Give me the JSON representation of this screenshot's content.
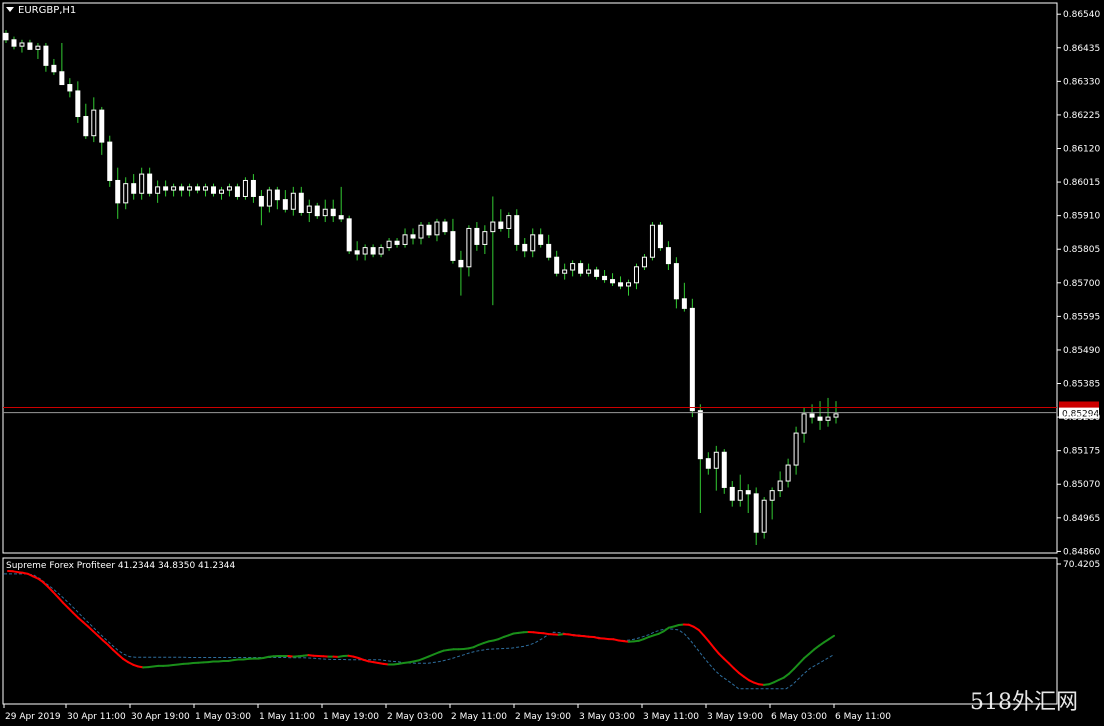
{
  "window": {
    "symbol": "EURGBP,H1"
  },
  "indicator": {
    "label": "Supreme Forex Profiteer 41.2344 34.8350 41.2344"
  },
  "watermark": {
    "text": "518外汇网"
  },
  "colors": {
    "bull": "#ffffff",
    "bear": "#ffffff",
    "wick": "#33cc33",
    "axis": "#ffffff",
    "priceline": "#cc0000",
    "ind_up": "#1a8f1a",
    "ind_down": "#ff0000",
    "ind_signal": "#2e6e9e"
  },
  "chart_data": {
    "type": "candlestick",
    "title": "EURGBP,H1",
    "ylim": [
      0.8488,
      0.8655
    ],
    "y_ticks": [
      "0.86540",
      "0.86435",
      "0.86330",
      "0.86225",
      "0.86120",
      "0.86015",
      "0.85910",
      "0.85805",
      "0.85700",
      "0.85595",
      "0.85490",
      "0.85385",
      "0.85280",
      "0.85175",
      "0.85070",
      "0.84965",
      "0.84860"
    ],
    "x_labels": [
      "29 Apr 2019",
      "30 Apr 11:00",
      "30 Apr 19:00",
      "1 May 03:00",
      "1 May 11:00",
      "1 May 19:00",
      "2 May 03:00",
      "2 May 11:00",
      "2 May 19:00",
      "3 May 03:00",
      "3 May 11:00",
      "3 May 19:00",
      "6 May 03:00",
      "6 May 11:00"
    ],
    "current_price_label": "0.85294",
    "current_price": 0.85294,
    "red_line_price": 0.8531,
    "indicator_scale_label": "70.4205",
    "candles": [
      [
        0.8648,
        0.8649,
        0.8645,
        0.8646
      ],
      [
        0.8646,
        0.8647,
        0.8643,
        0.8644
      ],
      [
        0.8644,
        0.8646,
        0.8642,
        0.8645
      ],
      [
        0.8645,
        0.8646,
        0.8643,
        0.8643
      ],
      [
        0.8643,
        0.8645,
        0.864,
        0.8644
      ],
      [
        0.8644,
        0.8645,
        0.8636,
        0.8638
      ],
      [
        0.8638,
        0.864,
        0.8635,
        0.8636
      ],
      [
        0.8636,
        0.8645,
        0.8634,
        0.8632
      ],
      [
        0.8632,
        0.8634,
        0.8628,
        0.863
      ],
      [
        0.863,
        0.8633,
        0.862,
        0.8622
      ],
      [
        0.8622,
        0.8626,
        0.8615,
        0.8616
      ],
      [
        0.8616,
        0.8628,
        0.8614,
        0.8624
      ],
      [
        0.8624,
        0.8625,
        0.861,
        0.8614
      ],
      [
        0.8614,
        0.8616,
        0.86,
        0.8602
      ],
      [
        0.8602,
        0.8606,
        0.859,
        0.8595
      ],
      [
        0.8595,
        0.8603,
        0.8593,
        0.8601
      ],
      [
        0.8601,
        0.8604,
        0.8596,
        0.8598
      ],
      [
        0.8598,
        0.8606,
        0.8596,
        0.8604
      ],
      [
        0.8604,
        0.8606,
        0.8597,
        0.8598
      ],
      [
        0.8598,
        0.8602,
        0.8595,
        0.86
      ],
      [
        0.86,
        0.8602,
        0.8597,
        0.8599
      ],
      [
        0.8599,
        0.8601,
        0.8597,
        0.86
      ],
      [
        0.86,
        0.8601,
        0.8597,
        0.8599
      ],
      [
        0.8599,
        0.8601,
        0.8597,
        0.86
      ],
      [
        0.86,
        0.8601,
        0.8598,
        0.8599
      ],
      [
        0.8599,
        0.8601,
        0.8597,
        0.86
      ],
      [
        0.86,
        0.8601,
        0.8597,
        0.8598
      ],
      [
        0.8598,
        0.86,
        0.8596,
        0.8599
      ],
      [
        0.8599,
        0.8601,
        0.8597,
        0.86
      ],
      [
        0.86,
        0.8601,
        0.8596,
        0.8597
      ],
      [
        0.8597,
        0.8603,
        0.8596,
        0.8602
      ],
      [
        0.8602,
        0.8604,
        0.8595,
        0.8597
      ],
      [
        0.8597,
        0.8599,
        0.8588,
        0.8594
      ],
      [
        0.8594,
        0.86,
        0.8592,
        0.8599
      ],
      [
        0.8599,
        0.86,
        0.8593,
        0.8596
      ],
      [
        0.8596,
        0.8599,
        0.8592,
        0.8593
      ],
      [
        0.8593,
        0.86,
        0.8591,
        0.8598
      ],
      [
        0.8598,
        0.86,
        0.8591,
        0.8592
      ],
      [
        0.8592,
        0.8596,
        0.8589,
        0.8594
      ],
      [
        0.8594,
        0.8595,
        0.859,
        0.8591
      ],
      [
        0.8591,
        0.8596,
        0.8589,
        0.8593
      ],
      [
        0.8593,
        0.8596,
        0.8589,
        0.8591
      ],
      [
        0.8591,
        0.86,
        0.8589,
        0.859
      ],
      [
        0.859,
        0.8591,
        0.8579,
        0.858
      ],
      [
        0.858,
        0.8583,
        0.8577,
        0.8579
      ],
      [
        0.8579,
        0.8582,
        0.8577,
        0.8581
      ],
      [
        0.8581,
        0.8582,
        0.8578,
        0.8579
      ],
      [
        0.8579,
        0.8582,
        0.8578,
        0.8581
      ],
      [
        0.8581,
        0.8584,
        0.858,
        0.8583
      ],
      [
        0.8583,
        0.8584,
        0.8581,
        0.8582
      ],
      [
        0.8582,
        0.8587,
        0.8581,
        0.8585
      ],
      [
        0.8585,
        0.8587,
        0.8582,
        0.8584
      ],
      [
        0.8584,
        0.8589,
        0.8582,
        0.8588
      ],
      [
        0.8588,
        0.8589,
        0.8584,
        0.8585
      ],
      [
        0.8585,
        0.859,
        0.8583,
        0.8589
      ],
      [
        0.8589,
        0.859,
        0.8585,
        0.8586
      ],
      [
        0.8586,
        0.859,
        0.8576,
        0.8577
      ],
      [
        0.8577,
        0.858,
        0.8566,
        0.8575
      ],
      [
        0.8575,
        0.8588,
        0.8572,
        0.8587
      ],
      [
        0.8587,
        0.8589,
        0.858,
        0.8582
      ],
      [
        0.8582,
        0.8588,
        0.8579,
        0.8586
      ],
      [
        0.8586,
        0.8597,
        0.8563,
        0.8589
      ],
      [
        0.8589,
        0.8593,
        0.8586,
        0.8587
      ],
      [
        0.8587,
        0.8592,
        0.8584,
        0.8591
      ],
      [
        0.8591,
        0.8593,
        0.858,
        0.8582
      ],
      [
        0.8582,
        0.8584,
        0.8578,
        0.858
      ],
      [
        0.858,
        0.8587,
        0.8578,
        0.8585
      ],
      [
        0.8585,
        0.8587,
        0.8581,
        0.8582
      ],
      [
        0.8582,
        0.8585,
        0.8577,
        0.8578
      ],
      [
        0.8578,
        0.858,
        0.8572,
        0.8573
      ],
      [
        0.8573,
        0.8576,
        0.8571,
        0.8574
      ],
      [
        0.8574,
        0.8577,
        0.8572,
        0.8576
      ],
      [
        0.8576,
        0.8577,
        0.8572,
        0.8573
      ],
      [
        0.8573,
        0.8576,
        0.8572,
        0.8574
      ],
      [
        0.8574,
        0.8575,
        0.8571,
        0.8572
      ],
      [
        0.8572,
        0.8574,
        0.857,
        0.8571
      ],
      [
        0.8571,
        0.8573,
        0.8569,
        0.857
      ],
      [
        0.857,
        0.8572,
        0.8568,
        0.8569
      ],
      [
        0.8569,
        0.8571,
        0.8566,
        0.857
      ],
      [
        0.857,
        0.8576,
        0.8568,
        0.8575
      ],
      [
        0.8575,
        0.8579,
        0.8574,
        0.8578
      ],
      [
        0.8578,
        0.8589,
        0.8577,
        0.8588
      ],
      [
        0.8588,
        0.8589,
        0.858,
        0.8581
      ],
      [
        0.8581,
        0.8583,
        0.8574,
        0.8576
      ],
      [
        0.8576,
        0.8578,
        0.8562,
        0.8565
      ],
      [
        0.8565,
        0.857,
        0.8561,
        0.8562
      ],
      [
        0.8562,
        0.8565,
        0.8528,
        0.853
      ],
      [
        0.853,
        0.8532,
        0.8498,
        0.8515
      ],
      [
        0.8515,
        0.8517,
        0.851,
        0.8512
      ],
      [
        0.8512,
        0.8519,
        0.8505,
        0.8517
      ],
      [
        0.8517,
        0.8518,
        0.8504,
        0.8506
      ],
      [
        0.8506,
        0.8508,
        0.85,
        0.8502
      ],
      [
        0.8502,
        0.851,
        0.85,
        0.8505
      ],
      [
        0.8505,
        0.8507,
        0.8498,
        0.8504
      ],
      [
        0.8504,
        0.8506,
        0.8488,
        0.8492
      ],
      [
        0.8492,
        0.8503,
        0.849,
        0.8502
      ],
      [
        0.8502,
        0.8506,
        0.8496,
        0.8505
      ],
      [
        0.8505,
        0.8511,
        0.8503,
        0.8508
      ],
      [
        0.8508,
        0.8515,
        0.8506,
        0.8513
      ],
      [
        0.8513,
        0.8525,
        0.851,
        0.8523
      ],
      [
        0.8523,
        0.8531,
        0.852,
        0.8529
      ],
      [
        0.8529,
        0.8532,
        0.8526,
        0.8528
      ],
      [
        0.8528,
        0.8533,
        0.8524,
        0.8527
      ],
      [
        0.8527,
        0.8534,
        0.8525,
        0.8528
      ],
      [
        0.8528,
        0.8533,
        0.8526,
        0.8529
      ]
    ],
    "indicator": {
      "name": "Supreme Forex Profiteer",
      "ylim": [
        0,
        70.4205
      ],
      "main": [
        70.4,
        70.3,
        70.0,
        69.8,
        69.4,
        68.6,
        67.8,
        66.6,
        65.0,
        63.2,
        61.4,
        59.5,
        57.8,
        56.1,
        54.4,
        52.9,
        51.4,
        49.8,
        48.2,
        46.6,
        45.1,
        43.4,
        41.8,
        40.3,
        39.2,
        38.3,
        37.7,
        37.4,
        37.5,
        37.7,
        37.9,
        37.9,
        38.0,
        38.2,
        38.4,
        38.6,
        38.7,
        38.9,
        39.0,
        39.1,
        39.2,
        39.4,
        39.4,
        39.6,
        39.6,
        39.9,
        40.1,
        40.1,
        40.3,
        40.4,
        40.4,
        40.6,
        41.0,
        41.2,
        41.3,
        41.3,
        41.3,
        41.1,
        41.2,
        41.4,
        41.6,
        41.4,
        41.3,
        41.2,
        41.1,
        41.1,
        41.0,
        41.3,
        41.4,
        41.1,
        40.6,
        40.0,
        39.5,
        39.2,
        38.9,
        38.6,
        38.4,
        38.4,
        38.6,
        38.9,
        39.1,
        39.4,
        39.8,
        40.4,
        41.1,
        41.8,
        42.5,
        43.1,
        43.4,
        43.6,
        43.6,
        43.7,
        43.9,
        44.3,
        45.1,
        45.7,
        46.3,
        46.6,
        47.1,
        47.8,
        48.4,
        49.0,
        49.2,
        49.4,
        49.5,
        49.4,
        49.2,
        49.1,
        48.8,
        48.7,
        48.6,
        48.8,
        48.7,
        48.4,
        48.2,
        48.1,
        47.9,
        47.8,
        47.4,
        47.3,
        47.1,
        47.0,
        46.6,
        46.4,
        46.2,
        46.3,
        46.5,
        47.1,
        47.8,
        48.4,
        48.9,
        49.8,
        51.0,
        51.4,
        51.9,
        52.1,
        52.0,
        51.3,
        50.2,
        48.3,
        46.3,
        44.1,
        42.1,
        40.4,
        38.8,
        37.1,
        35.5,
        34.2,
        33.0,
        32.2,
        31.6,
        31.4,
        31.6,
        32.3,
        33.1,
        33.9,
        35.2,
        36.9,
        38.7,
        40.5,
        42.0,
        43.5,
        44.8,
        46.0,
        47.1,
        48.2
      ],
      "signal": [
        69.4,
        69.4,
        69.4,
        69.4,
        69.4,
        69.0,
        67.8,
        66.2,
        64.6,
        62.9,
        61.1,
        59.1,
        57.1,
        55.0,
        53.0,
        51.0,
        49.0,
        47.1,
        45.2,
        43.4,
        42.0,
        41.1,
        40.9,
        40.9,
        40.9,
        40.9,
        40.9,
        40.9,
        40.9,
        40.9,
        40.9,
        40.8,
        40.8,
        40.8,
        40.8,
        40.8,
        40.8,
        40.8,
        40.8,
        40.8,
        40.8,
        40.8,
        40.8,
        40.8,
        40.8,
        40.8,
        40.8,
        40.8,
        40.7,
        40.7,
        40.7,
        40.6,
        40.5,
        40.3,
        40.2,
        40.1,
        40.1,
        40.1,
        40.0,
        40.0,
        40.0,
        40.0,
        40.0,
        40.0,
        39.7,
        39.5,
        39.3,
        39.0,
        38.9,
        38.8,
        38.8,
        38.8,
        39.1,
        39.4,
        39.9,
        40.4,
        41.1,
        41.7,
        42.4,
        42.9,
        43.3,
        43.6,
        43.7,
        43.8,
        43.9,
        44.0,
        44.3,
        44.6,
        45.1,
        45.9,
        47.1,
        48.4,
        49.4,
        49.3,
        49.0,
        48.7,
        48.5,
        48.3,
        48.0,
        47.9,
        47.5,
        47.2,
        46.9,
        46.7,
        46.6,
        46.8,
        47.3,
        47.9,
        48.6,
        49.6,
        50.2,
        50.6,
        50.5,
        50.2,
        48.8,
        46.5,
        43.9,
        41.3,
        38.8,
        36.5,
        34.6,
        33.2,
        31.7,
        30.1,
        30.1,
        30.1,
        30.1,
        30.1,
        30.1,
        30.1,
        30.1,
        30.1,
        31.4,
        33.4,
        35.3,
        37.1,
        38.2,
        39.4,
        40.6,
        41.8
      ]
    }
  }
}
